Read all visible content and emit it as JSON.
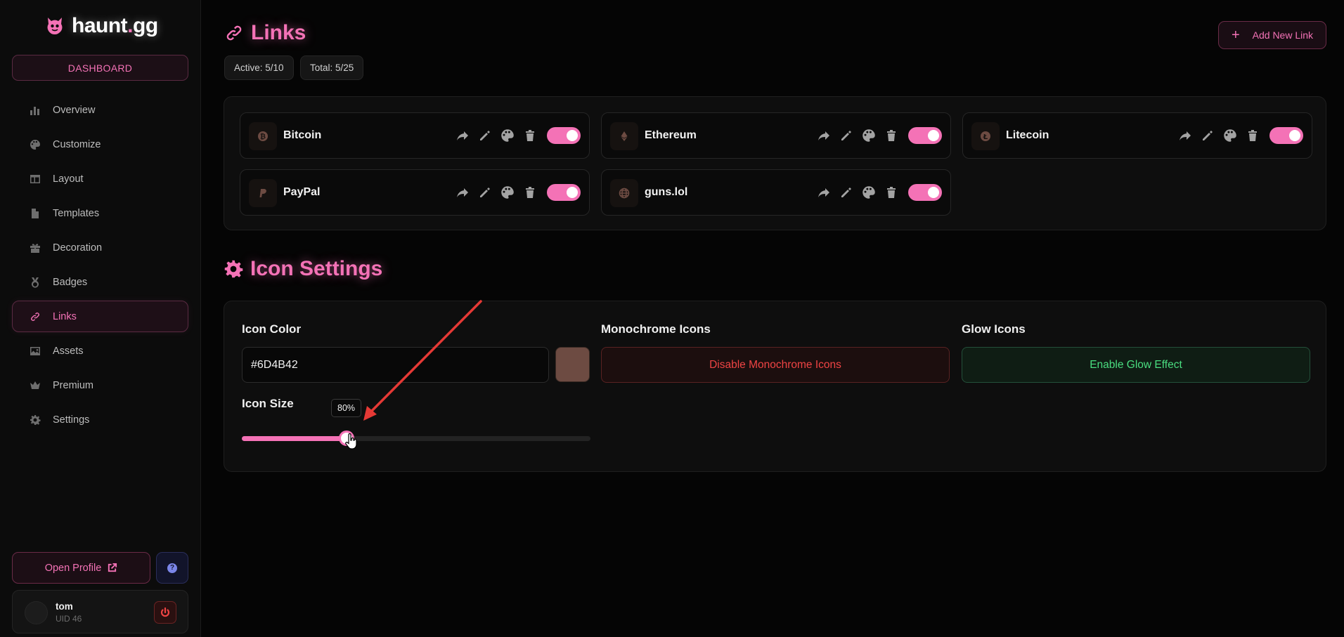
{
  "app": {
    "logo_main": "haunt",
    "logo_dot": ".",
    "logo_suffix": "gg",
    "dashboard_label": "DASHBOARD"
  },
  "sidebar": {
    "items": [
      {
        "label": "Overview",
        "icon": "bar-chart-icon"
      },
      {
        "label": "Customize",
        "icon": "palette-icon"
      },
      {
        "label": "Layout",
        "icon": "layout-icon"
      },
      {
        "label": "Templates",
        "icon": "file-icon"
      },
      {
        "label": "Decoration",
        "icon": "gift-icon"
      },
      {
        "label": "Badges",
        "icon": "medal-icon"
      },
      {
        "label": "Links",
        "icon": "link-icon",
        "active": true
      },
      {
        "label": "Assets",
        "icon": "image-icon"
      },
      {
        "label": "Premium",
        "icon": "crown-icon"
      },
      {
        "label": "Settings",
        "icon": "gear-icon"
      }
    ],
    "open_profile_label": "Open Profile",
    "help_glyph": "?",
    "user": {
      "name": "tom",
      "uid": "UID 46"
    }
  },
  "links_section": {
    "title": "Links",
    "add_button_label": "Add New Link",
    "stats": {
      "active": "Active: 5/10",
      "total": "Total: 5/25"
    },
    "links": [
      {
        "name": "Bitcoin",
        "icon": "bitcoin-icon",
        "enabled": true
      },
      {
        "name": "Ethereum",
        "icon": "ethereum-icon",
        "enabled": true
      },
      {
        "name": "Litecoin",
        "icon": "litecoin-icon",
        "enabled": true
      },
      {
        "name": "PayPal",
        "icon": "paypal-icon",
        "enabled": true
      },
      {
        "name": "guns.lol",
        "icon": "globe-icon",
        "enabled": true
      }
    ]
  },
  "icon_settings": {
    "title": "Icon Settings",
    "icon_color_label": "Icon Color",
    "icon_color_value": "#6D4B42",
    "monochrome_label": "Monochrome Icons",
    "monochrome_button": "Disable Monochrome Icons",
    "glow_label": "Glow Icons",
    "glow_button": "Enable Glow Effect",
    "size_label": "Icon Size",
    "size_value": 80,
    "size_display": "80%",
    "slider_fill_fraction": 0.3
  },
  "colors": {
    "accent": "#f472b6",
    "danger": "#ef4444",
    "success": "#4ade80",
    "icon_color": "#6D4B42"
  }
}
